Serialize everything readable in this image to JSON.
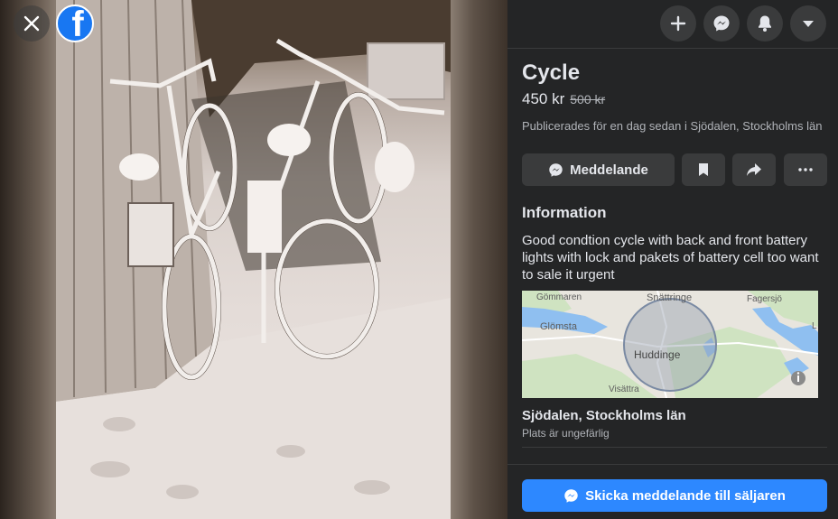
{
  "listing": {
    "title": "Cycle",
    "price": "450 kr",
    "old_price": "500 kr",
    "posted": "Publicerades för en dag sedan i Sjödalen, Stockholms län",
    "info_heading": "Information",
    "description": "Good condtion cycle with back and front battery lights with lock and pakets of battery cell too want to sale it urgent",
    "location": "Sjödalen, Stockholms län",
    "location_note": "Plats är ungefärlig"
  },
  "actions": {
    "message_label": "Meddelande",
    "send_label": "Skicka meddelande till säljaren"
  },
  "map": {
    "labels": {
      "gommaren": "Gömmaren",
      "snattringe": "Snättringe",
      "fagersjo": "Fagersjö",
      "glomsta": "Glömsta",
      "huddinge": "Huddinge",
      "visattra": "Visättra",
      "edge_l": "L"
    }
  },
  "icons": {
    "close": "close-icon",
    "logo": "facebook-logo",
    "add": "plus-icon",
    "messenger": "messenger-icon",
    "notifications": "bell-icon",
    "account": "caret-down-icon",
    "bookmark": "bookmark-icon",
    "share": "share-icon",
    "more": "more-icon"
  },
  "colors": {
    "panel_bg": "#242526",
    "button_bg": "#3a3b3c",
    "primary": "#2d88ff",
    "text": "#e4e6eb",
    "secondary_text": "#b0b3b8"
  }
}
